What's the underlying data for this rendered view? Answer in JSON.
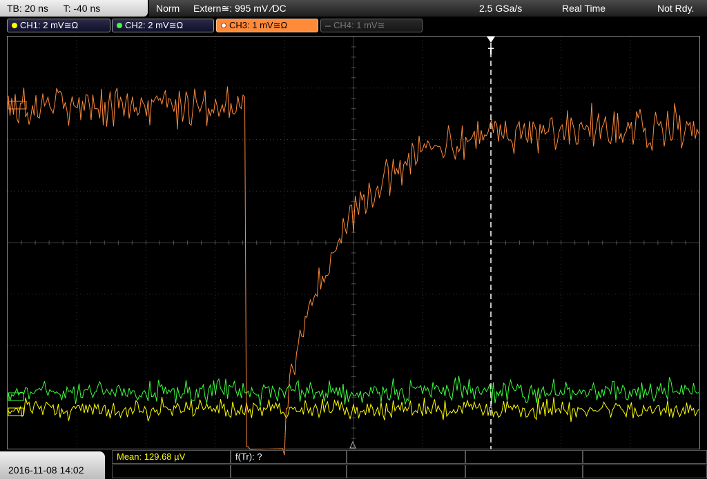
{
  "top_left": {
    "timebase": "TB: 20 ns",
    "trigger_time": "T: -40 ns"
  },
  "top_bar": {
    "mode": "Norm",
    "trigger_source": "Extern≅: 995 mV ⁄DC",
    "sample_rate": "2.5 GSa/s",
    "acq_mode": "Real Time",
    "status": "Not Rdy."
  },
  "channels": [
    {
      "label": "CH1: 2 mV≅Ω",
      "color": "#ffff00",
      "active": false,
      "enabled": true
    },
    {
      "label": "CH2: 2 mV≅Ω",
      "color": "#3cff3c",
      "active": false,
      "enabled": true
    },
    {
      "label": "CH3: 1 mV≅Ω",
      "color": "#ff8a3a",
      "active": true,
      "enabled": true
    },
    {
      "label": "CH4: 1 mV≅",
      "color": "#777777",
      "active": false,
      "enabled": false
    }
  ],
  "markers": {
    "trigger_marker": "T"
  },
  "footer": {
    "datetime": "2016-11-08 14:02",
    "measurement_1": "Mean: 129.68 µV",
    "measurement_2": "f(Tr): ?"
  },
  "colors": {
    "ch1": "#ffff00",
    "ch2": "#3cff3c",
    "ch3": "#ff8a3a",
    "grid": "#3a3a3a"
  }
}
